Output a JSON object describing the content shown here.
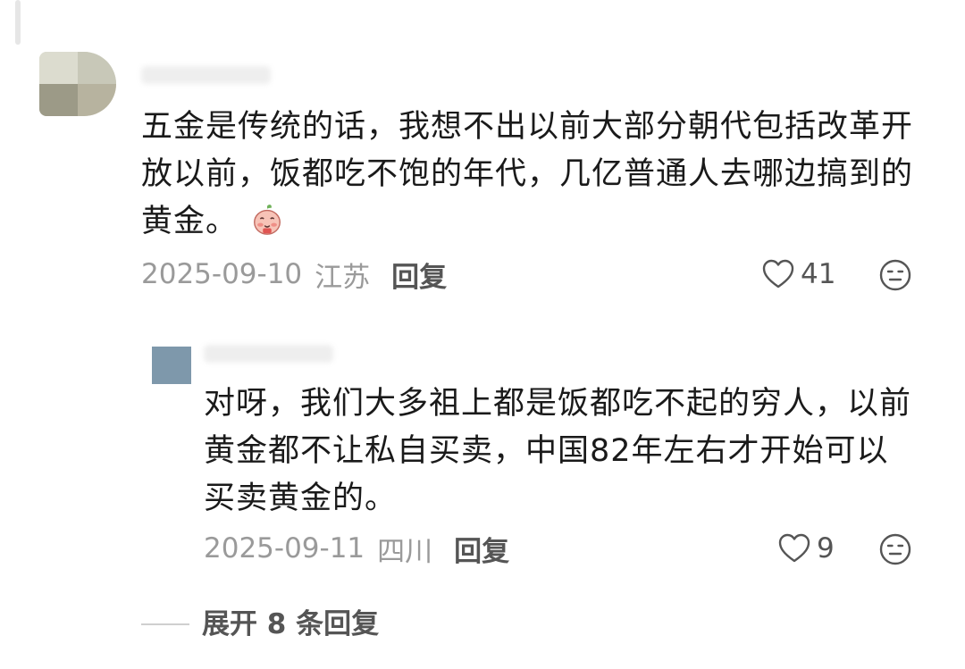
{
  "comment": {
    "text": "五金是传统的话，我想不出以前大部分朝代包括改革开放以前，饭都吃不饱的年代，几亿普通人去哪边搞到的黄金。",
    "date": "2025-09-10",
    "location": "江苏",
    "reply_label": "回复",
    "likes": "41",
    "emoji_icon": "peach-face-sticker"
  },
  "reply": {
    "text": "对呀，我们大多祖上都是饭都吃不起的穷人，以前黄金都不让私自买卖，中国82年左右才开始可以买卖黄金的。",
    "date": "2025-09-11",
    "location": "四川",
    "reply_label": "回复",
    "likes": "9"
  },
  "expand": {
    "label": "展开 8 条回复"
  },
  "colors": {
    "text": "#1a1a1a",
    "meta": "#9a9a9a",
    "action": "#555555"
  }
}
